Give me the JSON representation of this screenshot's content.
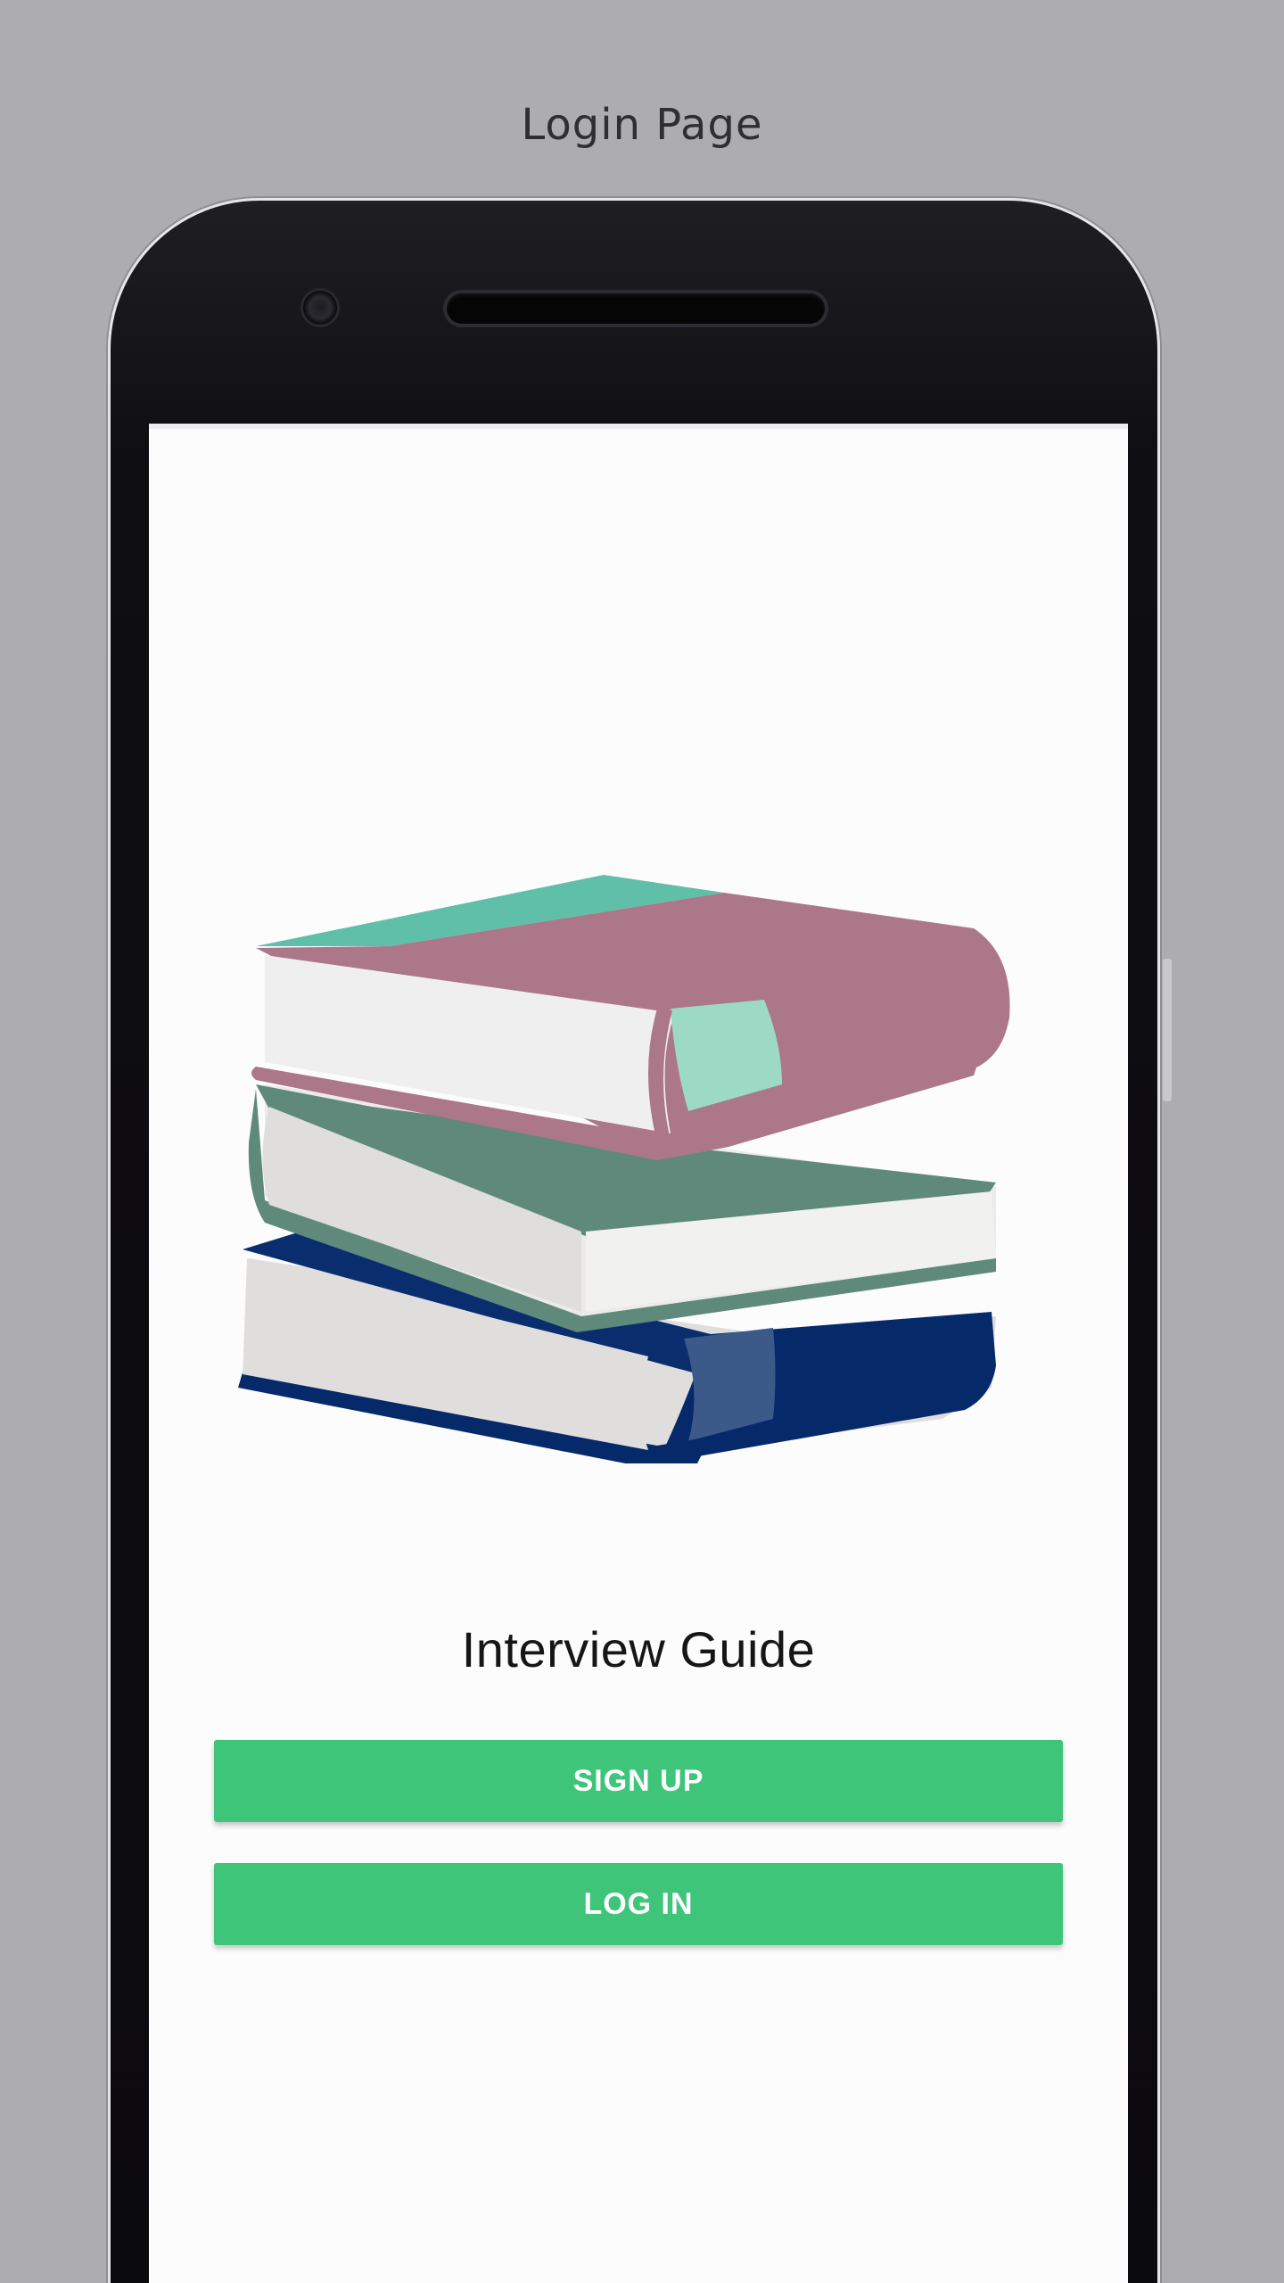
{
  "caption": "Login Page",
  "app": {
    "title": "Interview Guide",
    "signup_label": "SIGN UP",
    "login_label": "LOG IN"
  },
  "colors": {
    "background": "#adacae",
    "button": "#3ec57a",
    "book_top_cover": "#ab7789",
    "book_top_accent": "#5fbfa8",
    "book_middle_cover": "#5f8a7b",
    "book_bottom_cover": "#06296a"
  },
  "icons": [
    "books-logo-icon"
  ]
}
